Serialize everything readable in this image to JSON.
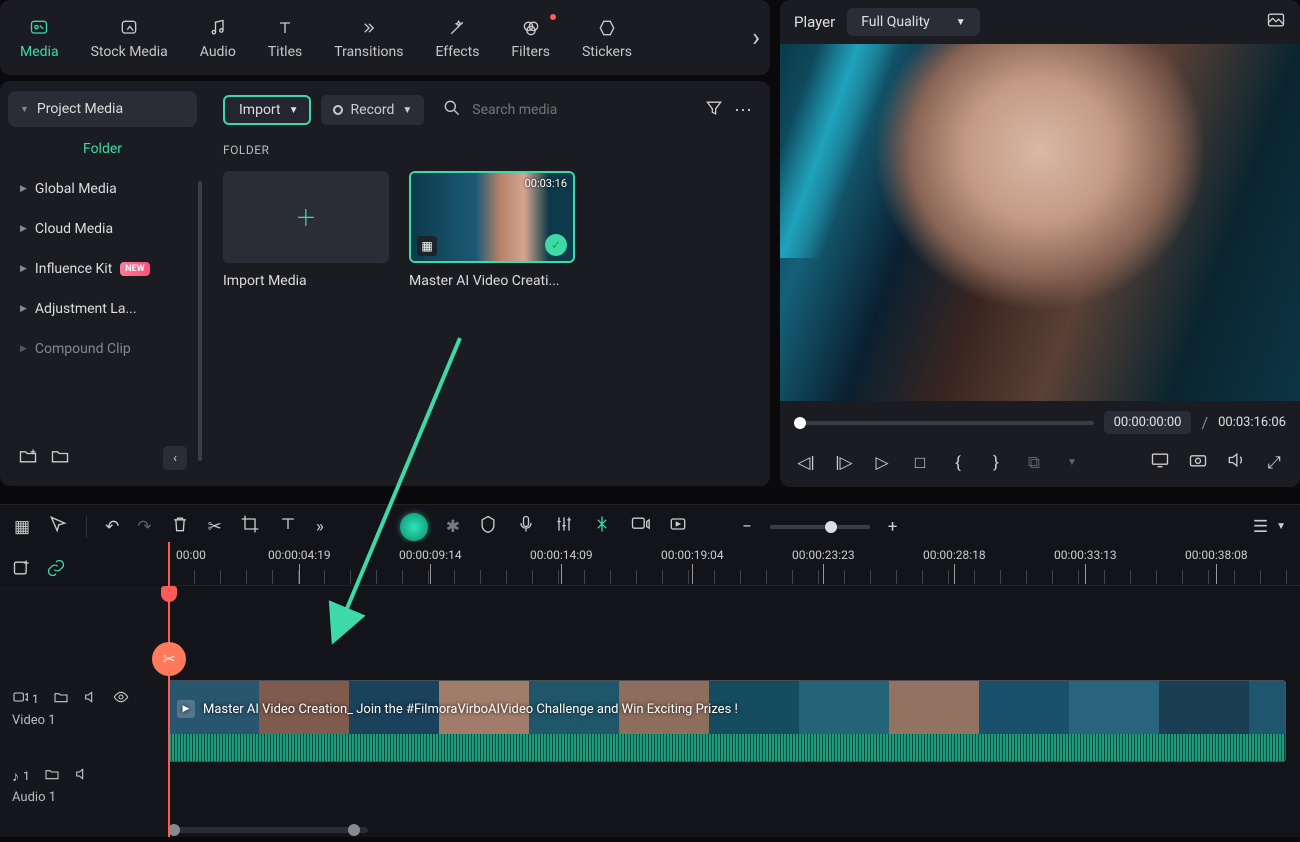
{
  "tabs": {
    "media": "Media",
    "stock": "Stock Media",
    "audio": "Audio",
    "titles": "Titles",
    "transitions": "Transitions",
    "effects": "Effects",
    "filters": "Filters",
    "stickers": "Stickers"
  },
  "sidebar": {
    "project_media": "Project Media",
    "folder": "Folder",
    "global_media": "Global Media",
    "cloud_media": "Cloud Media",
    "influence_kit": "Influence Kit",
    "influence_badge": "NEW",
    "adjustment": "Adjustment La...",
    "compound": "Compound Clip"
  },
  "media_toolbar": {
    "import": "Import",
    "record": "Record",
    "search_placeholder": "Search media"
  },
  "media_area": {
    "folder_heading": "FOLDER",
    "import_label": "Import Media",
    "clip_duration": "00:03:16",
    "clip_name": "Master AI Video Creati..."
  },
  "player": {
    "label": "Player",
    "quality": "Full Quality",
    "time_current": "00:00:00:00",
    "time_sep": "/",
    "time_total": "00:03:16:06"
  },
  "timeline": {
    "ruler": [
      "00:00",
      "00:00:04:19",
      "00:00:09:14",
      "00:00:14:09",
      "00:00:19:04",
      "00:00:23:23",
      "00:00:28:18",
      "00:00:33:13",
      "00:00:38:08"
    ],
    "track_video_num": "1",
    "track_video_label": "Video 1",
    "track_audio_num": "1",
    "track_audio_label": "Audio 1",
    "clip_title": "Master AI Video Creation_ Join the #FilmoraVirboAIVideo Challenge and Win Exciting Prizes !"
  }
}
